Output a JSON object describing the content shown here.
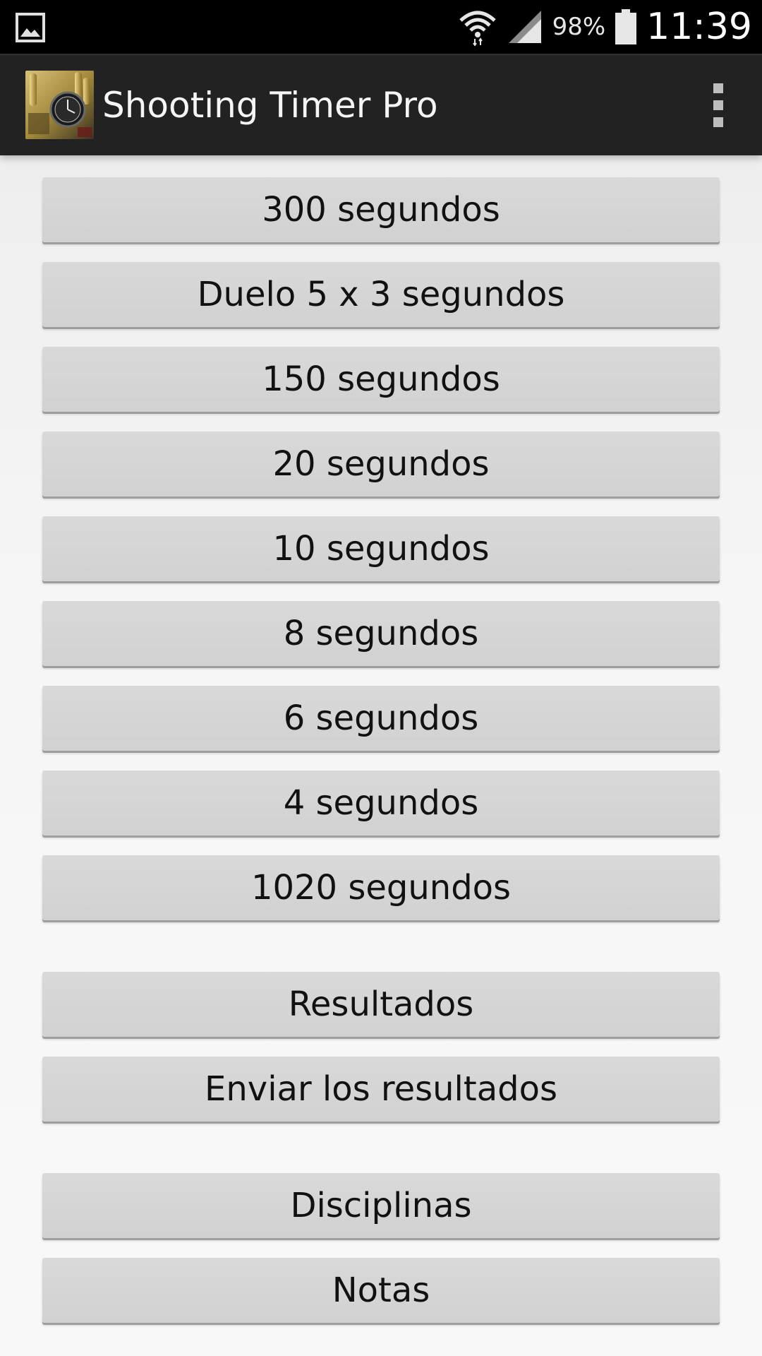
{
  "status_bar": {
    "battery_percent": "98%",
    "time": "11:39",
    "icons": [
      "gallery-notification-icon",
      "wifi-icon",
      "signal-icon",
      "battery-icon"
    ]
  },
  "action_bar": {
    "title": "Shooting Timer Pro",
    "app_icon": "app-logo-icon",
    "overflow_icon": "more-vert-icon",
    "background_color": "#222222"
  },
  "buttons": {
    "timers": [
      {
        "label": "300 segundos"
      },
      {
        "label": "Duelo 5 x 3 segundos"
      },
      {
        "label": "150 segundos"
      },
      {
        "label": "20 segundos"
      },
      {
        "label": "10 segundos"
      },
      {
        "label": "8 segundos"
      },
      {
        "label": "6 segundos"
      },
      {
        "label": "4 segundos"
      },
      {
        "label": "1020 segundos"
      }
    ],
    "results": "Resultados",
    "send_results": "Enviar los resultados",
    "disciplines": "Disciplinas",
    "notes": "Notas"
  }
}
